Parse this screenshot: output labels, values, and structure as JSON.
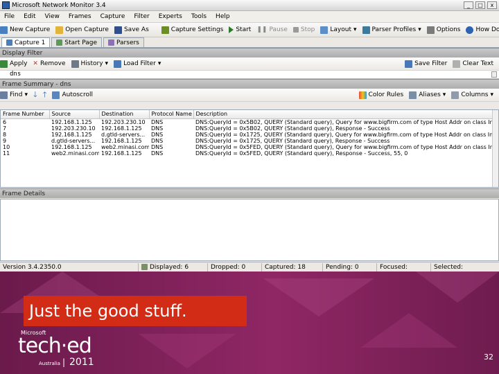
{
  "window": {
    "title": "Microsoft Network Monitor 3.4",
    "controls": [
      "_",
      "□",
      "x"
    ]
  },
  "menu": [
    "File",
    "Edit",
    "View",
    "Frames",
    "Capture",
    "Filter",
    "Experts",
    "Tools",
    "Help"
  ],
  "toolbar": {
    "new_capture": "New Capture",
    "open_capture": "Open Capture",
    "save_as": "Save As",
    "capture_settings": "Capture Settings",
    "start": "Start",
    "pause": "Pause",
    "stop": "Stop",
    "layout": "Layout",
    "parser_profiles": "Parser Profiles",
    "options": "Options",
    "how_do_i": "How Do I"
  },
  "tabs": [
    "Capture 1",
    "Start Page",
    "Parsers"
  ],
  "display_filter": {
    "header": "Display Filter",
    "apply": "Apply",
    "remove": "Remove",
    "history": "History",
    "load_filter": "Load Filter",
    "save_filter": "Save Filter",
    "clear_text": "Clear Text",
    "value": "dns"
  },
  "frame_summary": {
    "header": "Frame Summary - dns",
    "find": "Find",
    "autoscroll": "Autoscroll",
    "color_rules": "Color Rules",
    "aliases": "Aliases",
    "columns": "Columns",
    "columns_list": [
      "Frame Number",
      "Source",
      "Destination",
      "Protocol Name",
      "Description"
    ],
    "rows": [
      [
        "6",
        "192.168.1.125",
        "192.203.230.10",
        "DNS",
        "DNS:QueryId = 0x5B02, QUERY (Standard query), Query for www.bigfirm.com of type Host Addr on class Internet"
      ],
      [
        "7",
        "192.203.230.10",
        "192.168.1.125",
        "DNS",
        "DNS:QueryId = 0x5B02, QUERY (Standard query), Response - Success"
      ],
      [
        "8",
        "192.168.1.125",
        "d.gtld-servers...",
        "DNS",
        "DNS:QueryId = 0x1725, QUERY (Standard query), Query for www.bigfirm.com of type Host Addr on class Internet"
      ],
      [
        "9",
        "d.gtld-servers...",
        "192.168.1.125",
        "DNS",
        "DNS:QueryId = 0x1725, QUERY (Standard query), Response - Success"
      ],
      [
        "10",
        "192.168.1.125",
        "web2.minasi.com",
        "DNS",
        "DNS:QueryId = 0x5FED, QUERY (Standard query), Query for www.bigfirm.com of type Host Addr on class Internet"
      ],
      [
        "11",
        "web2.minasi.com",
        "192.168.1.125",
        "DNS",
        "DNS:QueryId = 0x5FED, QUERY (Standard query), Response - Success, 55, 0"
      ]
    ]
  },
  "frame_details": {
    "header": "Frame Details"
  },
  "status": {
    "version": "Version 3.4.2350.0",
    "displayed": "Displayed: 6",
    "dropped": "Dropped: 0",
    "captured": "Captured: 18",
    "pending": "Pending: 0",
    "focused": "Focused:",
    "selected": "Selected:"
  },
  "slide": {
    "caption": "Just the good stuff.",
    "brand_small": "Microsoft",
    "brand": "tech·ed",
    "location": "Australia",
    "year": "2011",
    "page": "32"
  },
  "colors": {
    "accent_red": "#d22b16",
    "slide_bg": "#7a1f55"
  }
}
